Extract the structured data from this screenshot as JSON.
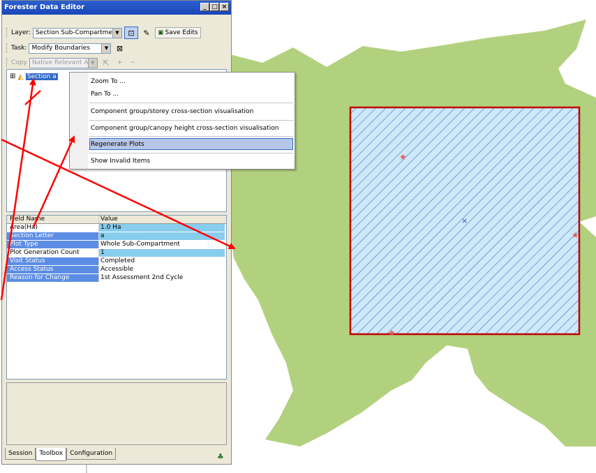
{
  "window": {
    "title": "Forester Data Editor",
    "controls": [
      "_",
      "□",
      "×"
    ]
  },
  "toolbar1": {
    "layer_label": "Layer:",
    "layer_value": "Section Sub-Compartment",
    "save_label": "Save Edits"
  },
  "toolbar2": {
    "task_label": "Task:",
    "task_value": "Modify Boundaries"
  },
  "toolbar3": {
    "copy_label": "Copy",
    "copy_value": "Native Relevant Adj",
    "plus": "+",
    "minus": "−"
  },
  "tree": {
    "expander": "⊞",
    "node_label": "Section a"
  },
  "context_menu": {
    "items": [
      "Zoom To ...",
      "Pan To ...",
      "Component group/storey cross-section visualisation",
      "Component group/canopy height cross-section visualisation",
      "Regenerate Plots",
      "Show Invalid Items"
    ],
    "selected_index": 4
  },
  "properties": {
    "headers": [
      "Field Name",
      "Value"
    ],
    "rows": [
      {
        "field": "Area(Ha)",
        "value": "1.0 Ha"
      },
      {
        "field": "Section Letter",
        "value": "a"
      },
      {
        "field": "Plot Type",
        "value": "Whole Sub-Compartment"
      },
      {
        "field": "Plot Generation Count",
        "value": "1"
      },
      {
        "field": "Visit Status",
        "value": "Completed"
      },
      {
        "field": "Access Status",
        "value": "Accessible"
      },
      {
        "field": "Reason for Change",
        "value": "1st Assessment 2nd Cycle"
      }
    ]
  },
  "tabs": [
    "Session",
    "Toolbox",
    "Configuration"
  ],
  "active_tab": "Toolbox",
  "colors": {
    "polygon_fill": "#b2d17e",
    "plot_border": "#c00000",
    "plot_fill": "#cde8f7",
    "hatch": "#3a6fd8",
    "arrow": "#ff0000",
    "star": "#e85a5a"
  }
}
